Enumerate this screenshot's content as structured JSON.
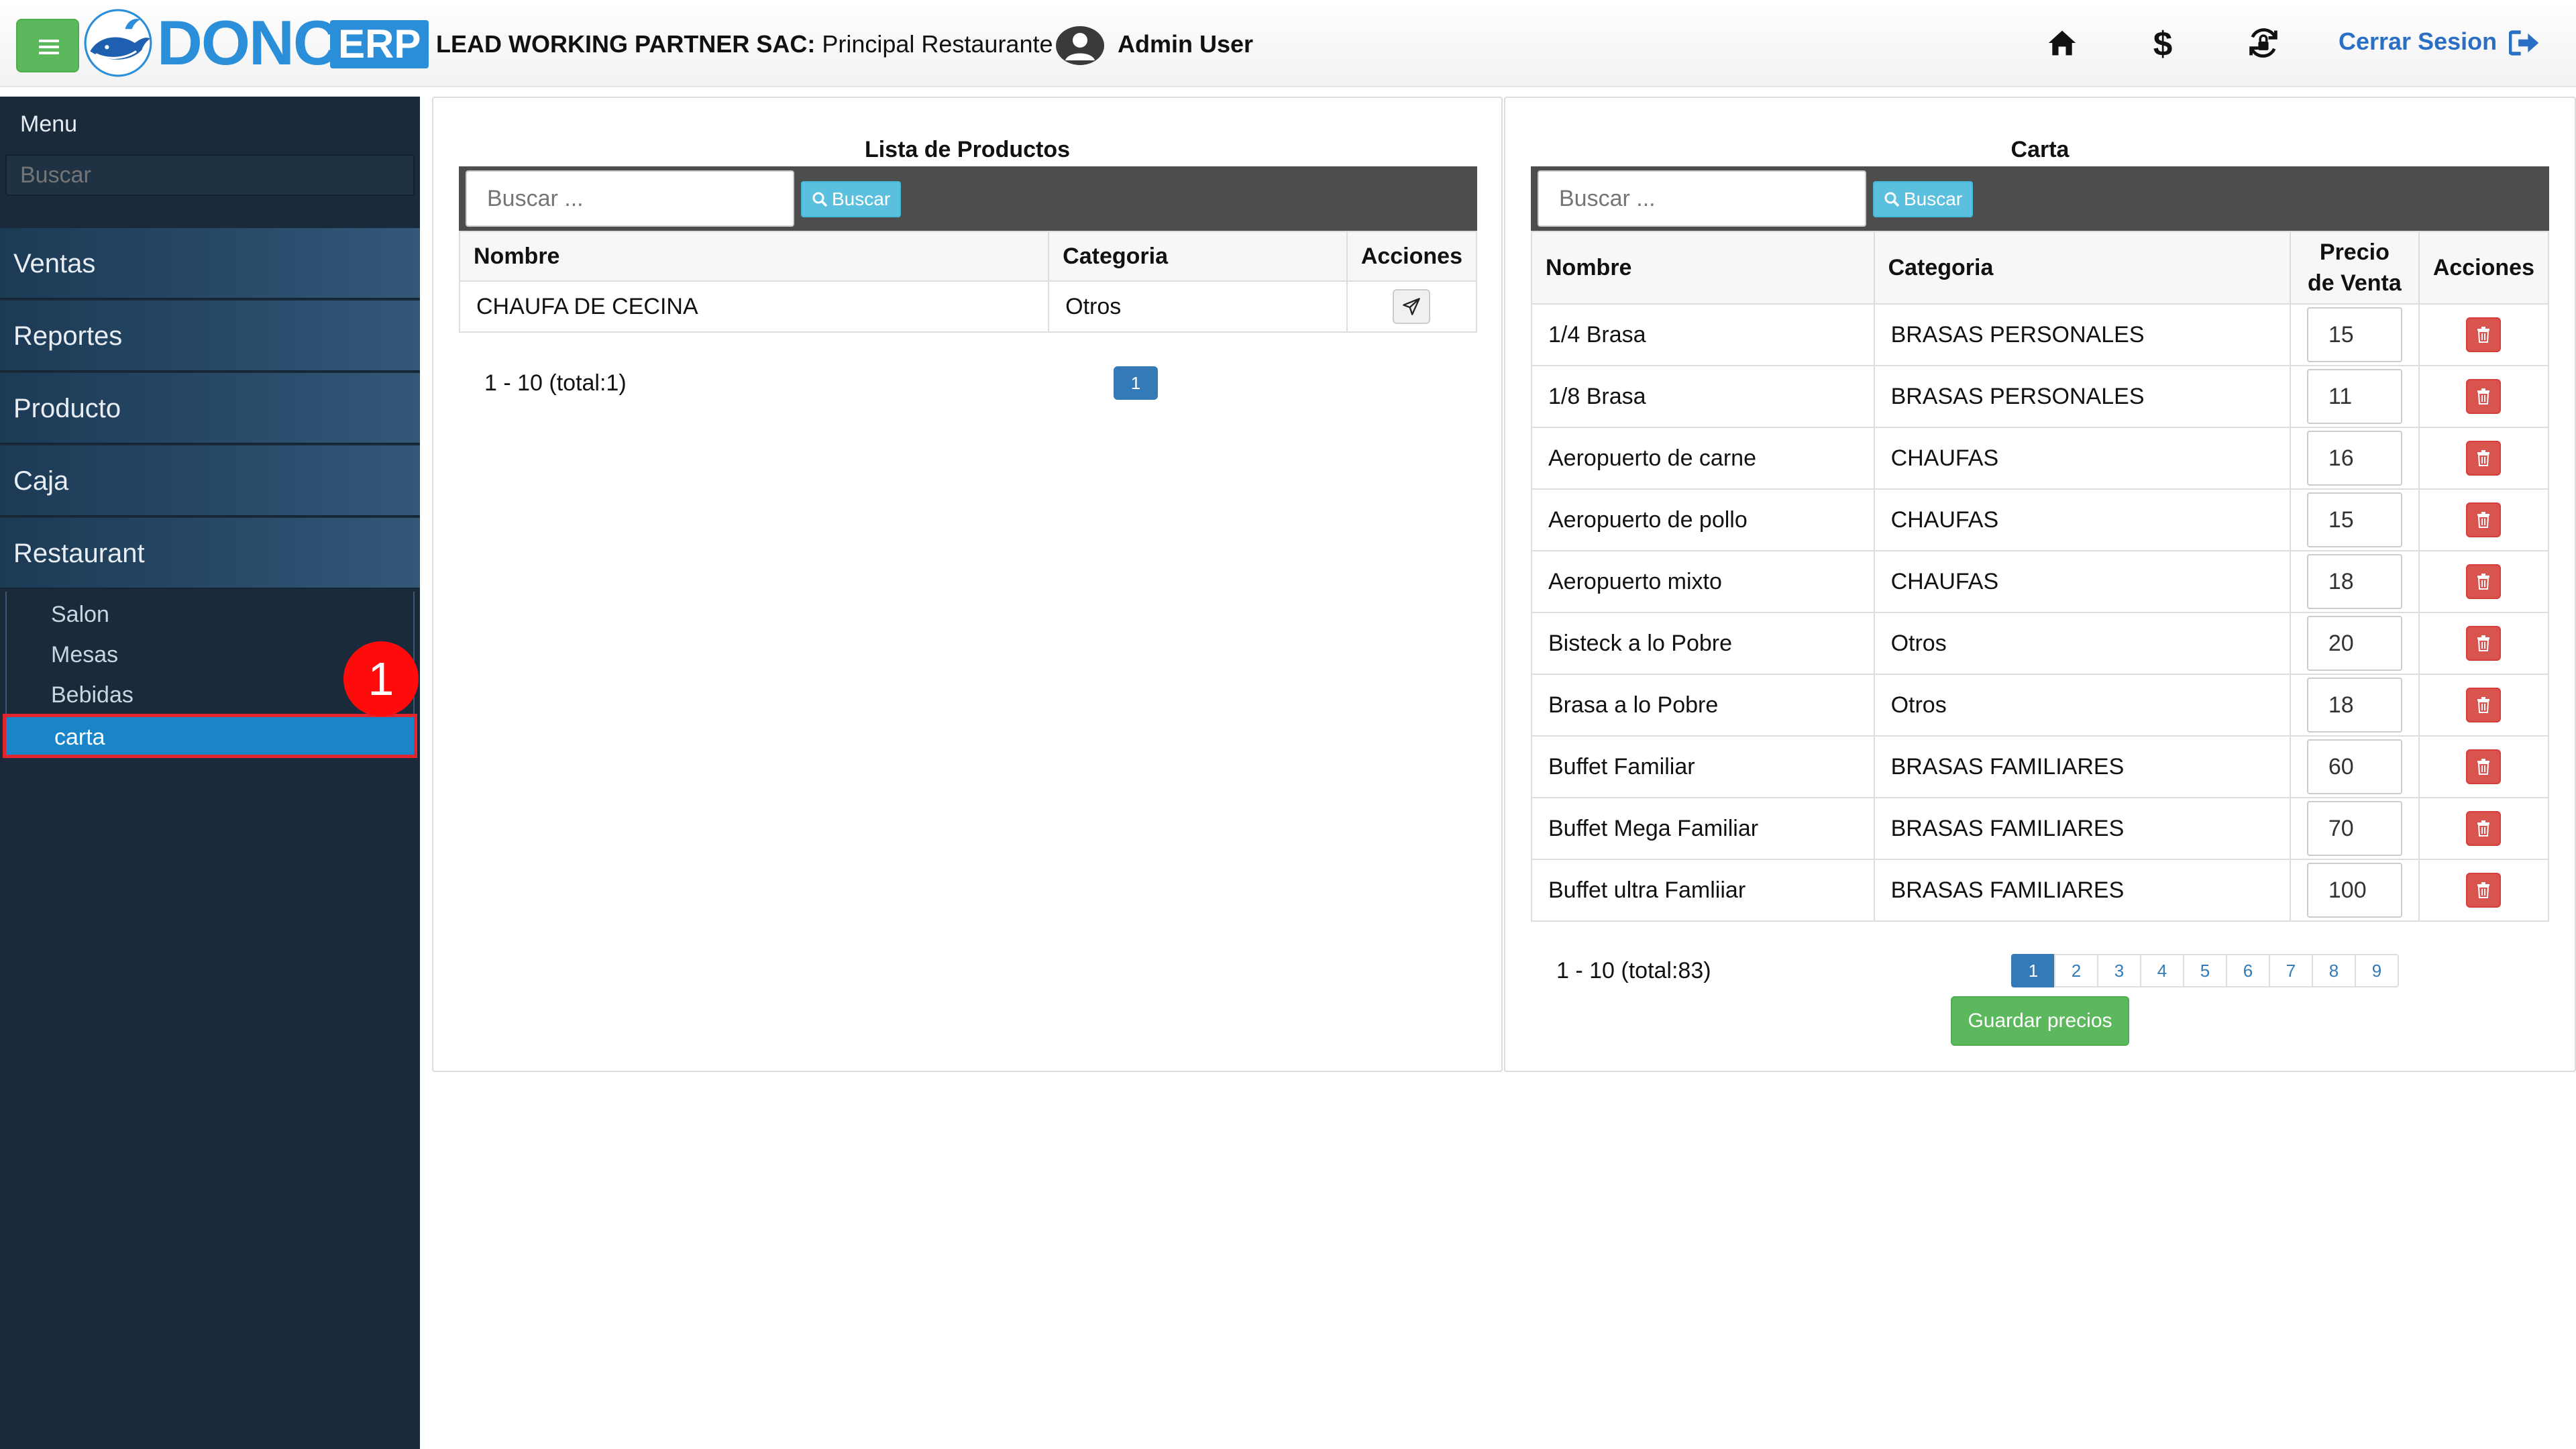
{
  "header": {
    "logo_text": "DONCA",
    "logo_badge": "ERP",
    "company_name": "LEAD WORKING PARTNER SAC:",
    "branch": " Principal Restaurante |",
    "user_name": "Admin User",
    "logout_label": "Cerrar Sesion",
    "icons": [
      "home-icon",
      "dollar-icon",
      "cash-register-icon",
      "logout-icon"
    ]
  },
  "sidebar": {
    "title": "Menu",
    "search_placeholder": "Buscar",
    "items": [
      {
        "label": "Ventas"
      },
      {
        "label": "Reportes"
      },
      {
        "label": "Producto"
      },
      {
        "label": "Caja"
      },
      {
        "label": "Restaurant"
      }
    ],
    "subitems": [
      {
        "label": "Salon"
      },
      {
        "label": "Mesas"
      },
      {
        "label": "Bebidas"
      },
      {
        "label": "carta"
      }
    ],
    "active_subitem": "carta",
    "annotation_badge": "1"
  },
  "products": {
    "title": "Lista de Productos",
    "search_placeholder": "Buscar ...",
    "search_button": "Buscar",
    "columns": [
      "Nombre",
      "Categoria",
      "Acciones"
    ],
    "rows": [
      {
        "name": "CHAUFA DE CECINA",
        "category": "Otros"
      }
    ],
    "page_info": "1 - 10 (total:1)",
    "pages": [
      "1"
    ]
  },
  "carta": {
    "title": "Carta",
    "search_placeholder": "Buscar ...",
    "search_button": "Buscar",
    "columns": [
      "Nombre",
      "Categoria",
      "Precio de Venta",
      "Acciones"
    ],
    "rows": [
      {
        "name": "1/4 Brasa",
        "category": "BRASAS PERSONALES",
        "price": "15"
      },
      {
        "name": "1/8 Brasa",
        "category": "BRASAS PERSONALES",
        "price": "11"
      },
      {
        "name": "Aeropuerto de carne",
        "category": "CHAUFAS",
        "price": "16"
      },
      {
        "name": "Aeropuerto de pollo",
        "category": "CHAUFAS",
        "price": "15"
      },
      {
        "name": "Aeropuerto mixto",
        "category": "CHAUFAS",
        "price": "18"
      },
      {
        "name": "Bisteck a lo Pobre",
        "category": "Otros",
        "price": "20"
      },
      {
        "name": "Brasa a lo Pobre",
        "category": "Otros",
        "price": "18"
      },
      {
        "name": "Buffet Familiar",
        "category": "BRASAS FAMILIARES",
        "price": "60"
      },
      {
        "name": "Buffet Mega Familiar",
        "category": "BRASAS FAMILIARES",
        "price": "70"
      },
      {
        "name": "Buffet ultra Famliiar",
        "category": "BRASAS FAMILIARES",
        "price": "100"
      }
    ],
    "page_info": "1 - 10 (total:83)",
    "pages": [
      "1",
      "2",
      "3",
      "4",
      "5",
      "6",
      "7",
      "8",
      "9"
    ],
    "current_page": "1",
    "save_label": "Guardar precios"
  },
  "colors": {
    "sidebar_bg": "#1b2a3a",
    "active_item": "#1a84c8",
    "highlight_border": "#e3262d",
    "primary": "#337ab7",
    "success": "#5cb85c",
    "info": "#5bc0de",
    "danger": "#d9534f"
  }
}
